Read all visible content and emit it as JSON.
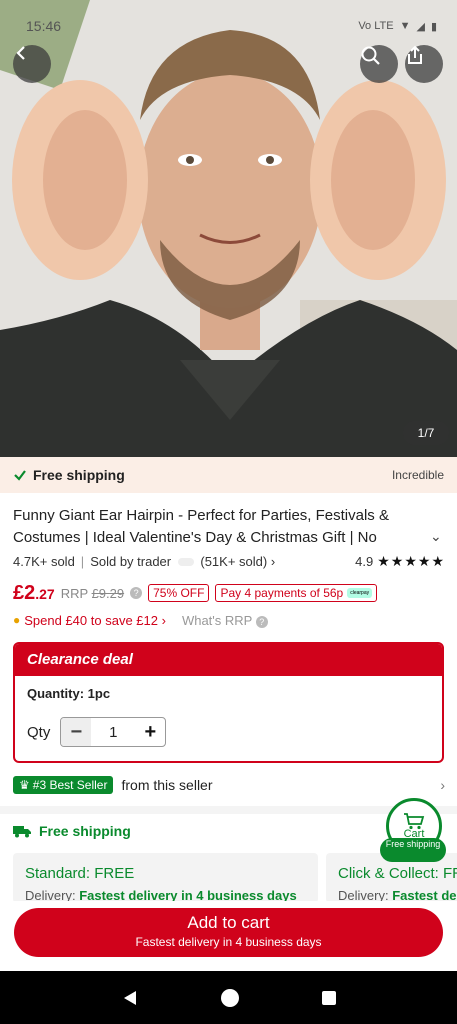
{
  "status": {
    "time": "15:46",
    "network": "Vo LTE"
  },
  "gallery": {
    "counter": "1/7"
  },
  "shipping_bar": {
    "label": "Free shipping",
    "tag": "Incredible"
  },
  "product": {
    "title": "Funny Giant Ear Hairpin - Perfect for Parties, Festivals & Costumes | Ideal Valentine's Day & Christmas Gift | No",
    "sold": "4.7K+ sold",
    "sold_by": "Sold by trader",
    "seller_sold": "(51K+ sold)",
    "rating": "4.9",
    "stars": "★★★★★"
  },
  "pricing": {
    "currency": "£",
    "price_int": "2",
    "price_dec": ".27",
    "rrp_label": "RRP",
    "rrp_value": "£9.29",
    "discount": "75% OFF",
    "pay_in": "Pay 4 payments of 56p",
    "clearpay": "clearpay"
  },
  "promo": {
    "spend": "Spend £40 to save £12",
    "whats_rrp": "What's RRP"
  },
  "deal": {
    "title": "Clearance deal",
    "quantity_label": "Quantity: 1pc",
    "qty_label": "Qty",
    "qty_value": "1"
  },
  "bestseller": {
    "badge": "#3 Best Seller",
    "text": "from this seller"
  },
  "shipping": {
    "title": "Free shipping",
    "standard_title": "Standard: FREE",
    "standard_delivery_label": "Delivery:",
    "standard_delivery": "Fastest delivery in 4 business days",
    "click_title": "Click & Collect: FREE",
    "click_delivery_label": "Delivery:",
    "click_delivery": "Fastest delivery"
  },
  "cart_fab": {
    "label": "Cart",
    "free": "Free shipping"
  },
  "cta": {
    "main": "Add to cart",
    "sub": "Fastest delivery in 4 business days"
  },
  "colors": {
    "accent": "#d0021b",
    "green": "#0a8a2d"
  }
}
